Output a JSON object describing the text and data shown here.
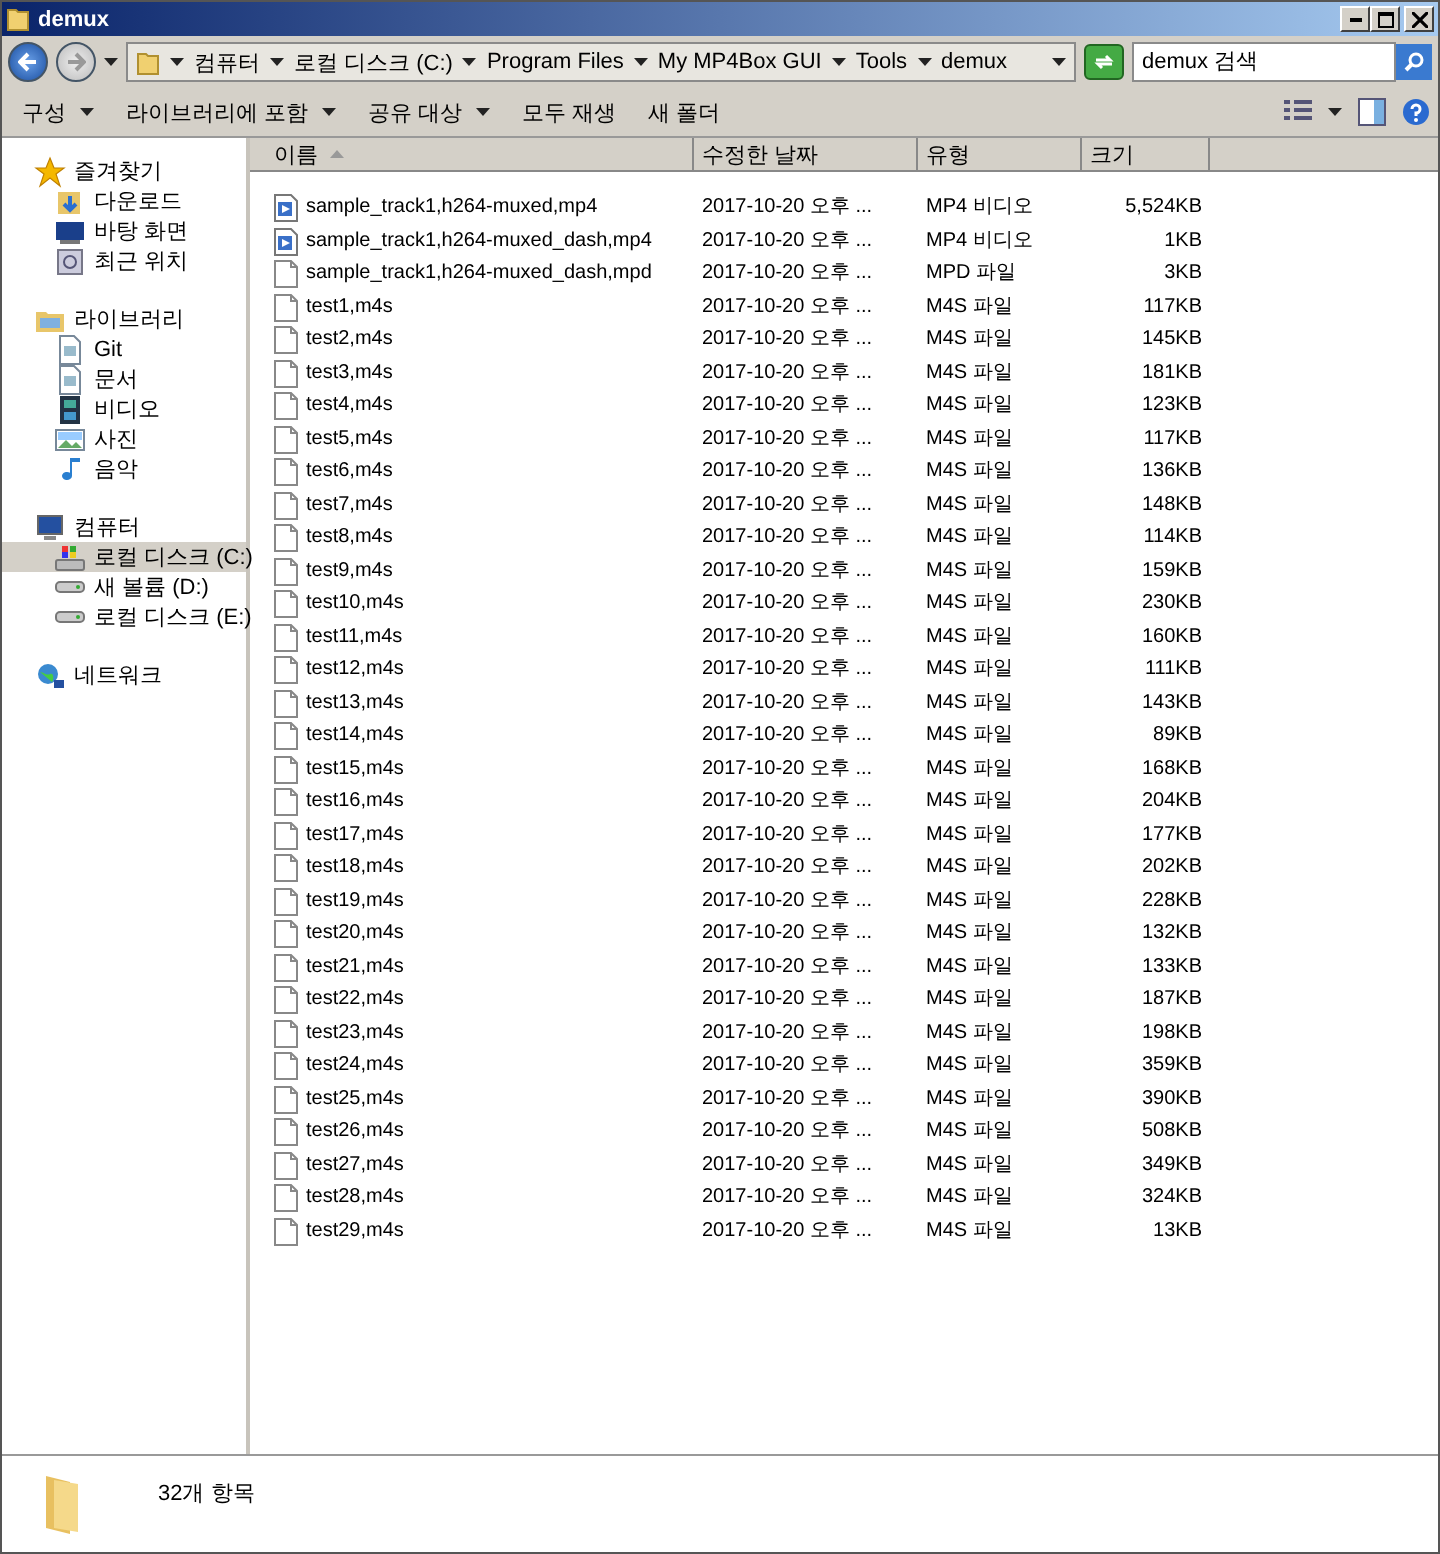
{
  "window": {
    "title": "demux"
  },
  "address": {
    "crumbs": [
      "컴퓨터",
      "로컬 디스크 (C:)",
      "Program Files",
      "My MP4Box GUI",
      "Tools",
      "demux"
    ]
  },
  "search": {
    "placeholder": "demux 검색"
  },
  "toolbar": {
    "menus": [
      {
        "label": "구성",
        "dropdown": true
      },
      {
        "label": "라이브러리에 포함",
        "dropdown": true
      },
      {
        "label": "공유 대상",
        "dropdown": true
      },
      {
        "label": "모두 재생",
        "dropdown": false
      },
      {
        "label": "새 폴더",
        "dropdown": false
      }
    ]
  },
  "sidebar": {
    "groups": [
      {
        "label": "즐겨찾기",
        "kind": "star",
        "children": [
          {
            "label": "다운로드",
            "kind": "download",
            "selected": false
          },
          {
            "label": "바탕 화면",
            "kind": "desktop",
            "selected": false
          },
          {
            "label": "최근 위치",
            "kind": "recent",
            "selected": false
          }
        ]
      },
      {
        "label": "라이브러리",
        "kind": "library",
        "children": [
          {
            "label": "Git",
            "kind": "doc",
            "selected": false
          },
          {
            "label": "문서",
            "kind": "doc",
            "selected": false
          },
          {
            "label": "비디오",
            "kind": "film",
            "selected": false
          },
          {
            "label": "사진",
            "kind": "photo",
            "selected": false
          },
          {
            "label": "음악",
            "kind": "music",
            "selected": false
          }
        ]
      },
      {
        "label": "컴퓨터",
        "kind": "computer",
        "children": [
          {
            "label": "로컬 디스크 (C:)",
            "kind": "sysdrive",
            "selected": true
          },
          {
            "label": "새 볼륨 (D:)",
            "kind": "drive",
            "selected": false
          },
          {
            "label": "로컬 디스크 (E:)",
            "kind": "drive",
            "selected": false
          }
        ]
      },
      {
        "label": "네트워크",
        "kind": "network"
      }
    ]
  },
  "table": {
    "columns": [
      "이름",
      "수정한 날짜",
      "유형",
      "크기"
    ],
    "rows": [
      {
        "kind": "video",
        "name": "sample_track1,h264-muxed,mp4",
        "date": "2017-10-20 오후 ...",
        "type": "MP4 비디오",
        "size": "5,524KB"
      },
      {
        "kind": "video",
        "name": "sample_track1,h264-muxed_dash,mp4",
        "date": "2017-10-20 오후 ...",
        "type": "MP4 비디오",
        "size": "1KB"
      },
      {
        "kind": "file",
        "name": "sample_track1,h264-muxed_dash,mpd",
        "date": "2017-10-20 오후 ...",
        "type": "MPD 파일",
        "size": "3KB"
      },
      {
        "kind": "file",
        "name": "test1,m4s",
        "date": "2017-10-20 오후 ...",
        "type": "M4S 파일",
        "size": "117KB"
      },
      {
        "kind": "file",
        "name": "test2,m4s",
        "date": "2017-10-20 오후 ...",
        "type": "M4S 파일",
        "size": "145KB"
      },
      {
        "kind": "file",
        "name": "test3,m4s",
        "date": "2017-10-20 오후 ...",
        "type": "M4S 파일",
        "size": "181KB"
      },
      {
        "kind": "file",
        "name": "test4,m4s",
        "date": "2017-10-20 오후 ...",
        "type": "M4S 파일",
        "size": "123KB"
      },
      {
        "kind": "file",
        "name": "test5,m4s",
        "date": "2017-10-20 오후 ...",
        "type": "M4S 파일",
        "size": "117KB"
      },
      {
        "kind": "file",
        "name": "test6,m4s",
        "date": "2017-10-20 오후 ...",
        "type": "M4S 파일",
        "size": "136KB"
      },
      {
        "kind": "file",
        "name": "test7,m4s",
        "date": "2017-10-20 오후 ...",
        "type": "M4S 파일",
        "size": "148KB"
      },
      {
        "kind": "file",
        "name": "test8,m4s",
        "date": "2017-10-20 오후 ...",
        "type": "M4S 파일",
        "size": "114KB"
      },
      {
        "kind": "file",
        "name": "test9,m4s",
        "date": "2017-10-20 오후 ...",
        "type": "M4S 파일",
        "size": "159KB"
      },
      {
        "kind": "file",
        "name": "test10,m4s",
        "date": "2017-10-20 오후 ...",
        "type": "M4S 파일",
        "size": "230KB"
      },
      {
        "kind": "file",
        "name": "test11,m4s",
        "date": "2017-10-20 오후 ...",
        "type": "M4S 파일",
        "size": "160KB"
      },
      {
        "kind": "file",
        "name": "test12,m4s",
        "date": "2017-10-20 오후 ...",
        "type": "M4S 파일",
        "size": "111KB"
      },
      {
        "kind": "file",
        "name": "test13,m4s",
        "date": "2017-10-20 오후 ...",
        "type": "M4S 파일",
        "size": "143KB"
      },
      {
        "kind": "file",
        "name": "test14,m4s",
        "date": "2017-10-20 오후 ...",
        "type": "M4S 파일",
        "size": "89KB"
      },
      {
        "kind": "file",
        "name": "test15,m4s",
        "date": "2017-10-20 오후 ...",
        "type": "M4S 파일",
        "size": "168KB"
      },
      {
        "kind": "file",
        "name": "test16,m4s",
        "date": "2017-10-20 오후 ...",
        "type": "M4S 파일",
        "size": "204KB"
      },
      {
        "kind": "file",
        "name": "test17,m4s",
        "date": "2017-10-20 오후 ...",
        "type": "M4S 파일",
        "size": "177KB"
      },
      {
        "kind": "file",
        "name": "test18,m4s",
        "date": "2017-10-20 오후 ...",
        "type": "M4S 파일",
        "size": "202KB"
      },
      {
        "kind": "file",
        "name": "test19,m4s",
        "date": "2017-10-20 오후 ...",
        "type": "M4S 파일",
        "size": "228KB"
      },
      {
        "kind": "file",
        "name": "test20,m4s",
        "date": "2017-10-20 오후 ...",
        "type": "M4S 파일",
        "size": "132KB"
      },
      {
        "kind": "file",
        "name": "test21,m4s",
        "date": "2017-10-20 오후 ...",
        "type": "M4S 파일",
        "size": "133KB"
      },
      {
        "kind": "file",
        "name": "test22,m4s",
        "date": "2017-10-20 오후 ...",
        "type": "M4S 파일",
        "size": "187KB"
      },
      {
        "kind": "file",
        "name": "test23,m4s",
        "date": "2017-10-20 오후 ...",
        "type": "M4S 파일",
        "size": "198KB"
      },
      {
        "kind": "file",
        "name": "test24,m4s",
        "date": "2017-10-20 오후 ...",
        "type": "M4S 파일",
        "size": "359KB"
      },
      {
        "kind": "file",
        "name": "test25,m4s",
        "date": "2017-10-20 오후 ...",
        "type": "M4S 파일",
        "size": "390KB"
      },
      {
        "kind": "file",
        "name": "test26,m4s",
        "date": "2017-10-20 오후 ...",
        "type": "M4S 파일",
        "size": "508KB"
      },
      {
        "kind": "file",
        "name": "test27,m4s",
        "date": "2017-10-20 오후 ...",
        "type": "M4S 파일",
        "size": "349KB"
      },
      {
        "kind": "file",
        "name": "test28,m4s",
        "date": "2017-10-20 오후 ...",
        "type": "M4S 파일",
        "size": "324KB"
      },
      {
        "kind": "file",
        "name": "test29,m4s",
        "date": "2017-10-20 오후 ...",
        "type": "M4S 파일",
        "size": "13KB"
      }
    ]
  },
  "status_bar": {
    "count": "32개 항목"
  }
}
